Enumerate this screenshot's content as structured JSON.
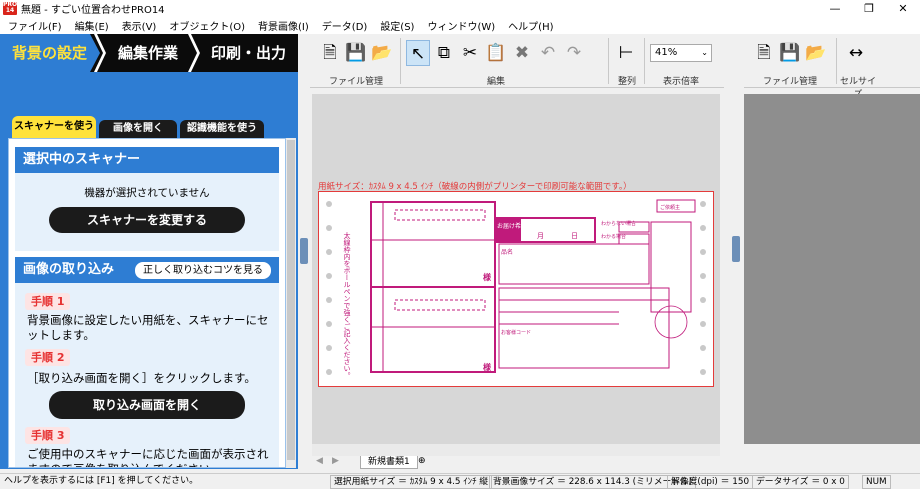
{
  "window": {
    "title": "無題 - すごい位置合わせPRO14",
    "app_icon_text": "PRO 14"
  },
  "menu": [
    "ファイル(F)",
    "編集(E)",
    "表示(V)",
    "オブジェクト(O)",
    "背景画像(I)",
    "データ(D)",
    "設定(S)",
    "ウィンドウ(W)",
    "ヘルプ(H)"
  ],
  "steps": [
    "背景の設定",
    "編集作業",
    "印刷・出力"
  ],
  "left_tabs": [
    "スキャナーを使う",
    "画像を開く",
    "認識機能を使う"
  ],
  "scanner": {
    "heading": "選択中のスキャナー",
    "status": "機器が選択されていません",
    "change_button": "スキャナーを変更する"
  },
  "capture": {
    "heading": "画像の取り込み",
    "tips_button": "正しく取り込むコツを見る",
    "step1_title": "手順 1",
    "step1_text": "背景画像に設定したい用紙を、スキャナーにセットします。",
    "step2_title": "手順 2",
    "step2_text": "［取り込み画面を開く］をクリックします。",
    "open_button": "取り込み画面を開く",
    "step3_title": "手順 3",
    "step3_text": "ご使用中のスキャナーに応じた画面が表示されますので画像を取り込んでください。"
  },
  "toolbar": {
    "groups": [
      "ファイル管理",
      "編集",
      "整列",
      "表示倍率"
    ],
    "zoom": "41%"
  },
  "right_toolbar": {
    "groups": [
      "ファイル管理",
      "セルサイズ"
    ]
  },
  "paper": {
    "size_label": "用紙サイズ：ｶｽﾀﾑ 9 x 4.5 ｲﾝﾁ（破線の内側がプリンターで印刷可能な範囲です。）",
    "texts": [
      "太線枠内をボールペンで強くご記入ください。",
      "お届け希望日",
      "月",
      "日",
      "品名",
      "様",
      "ご依頼主",
      "わからない場合",
      "わかる場合",
      "お客様コード"
    ]
  },
  "sheet_tab": "新規書類1",
  "status": {
    "help": "ヘルプを表示するには [F1] を押してください。",
    "paper": "選択用紙サイズ ＝ ｶｽﾀﾑ 9 x 4.5 ｲﾝﾁ 縦",
    "bg": "背景画像サイズ ＝ 228.6 x 114.3 (ミリメートル)",
    "dpi": "解像度(dpi) ＝ 150",
    "datasize": "データサイズ ＝ 0 x 0",
    "num": "NUM"
  }
}
